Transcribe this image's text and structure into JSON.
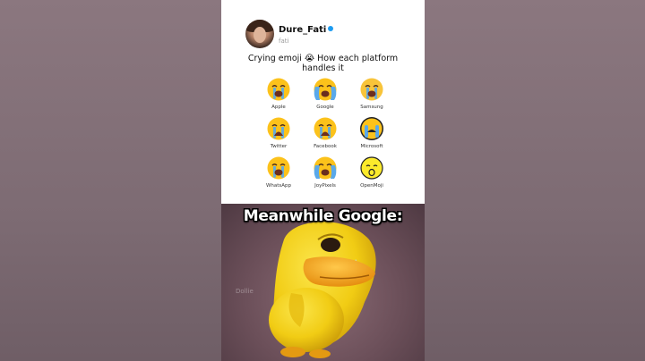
{
  "post": {
    "username": "Dure_Fati",
    "handle": "fati",
    "caption": "Crying emoji 😭 How each platform handles it"
  },
  "emojis": [
    {
      "label": "Apple",
      "style": "apple"
    },
    {
      "label": "Google",
      "style": "google"
    },
    {
      "label": "Samsung",
      "style": "samsung"
    },
    {
      "label": "Twitter",
      "style": "twitter"
    },
    {
      "label": "Facebook",
      "style": "facebook"
    },
    {
      "label": "Microsoft",
      "style": "microsoft"
    },
    {
      "label": "WhatsApp",
      "style": "whatsapp"
    },
    {
      "label": "JoyPixels",
      "style": "joypixels"
    },
    {
      "label": "OpenMoji",
      "style": "openmoji"
    }
  ],
  "meme": {
    "text": "Meanwhile Google:",
    "watermark": "Dollie"
  },
  "colors": {
    "face_yellow": "#fcc21b",
    "tear_blue": "#5aa9ea",
    "mouth_dark": "#6b2e1f",
    "duck_yellow": "#f4d21c",
    "duck_beak": "#f2a515"
  }
}
